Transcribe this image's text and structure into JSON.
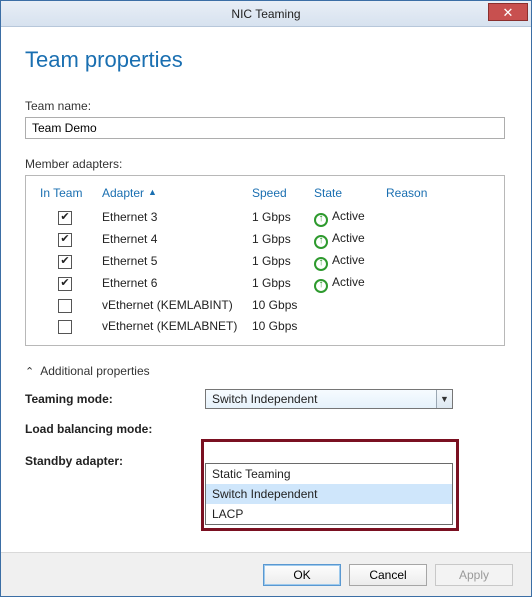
{
  "window": {
    "title": "NIC Teaming",
    "close_glyph": "✕"
  },
  "heading": "Team properties",
  "team_name": {
    "label": "Team name:",
    "value": "Team Demo"
  },
  "member_adapters": {
    "label": "Member adapters:",
    "columns": {
      "in_team": "In Team",
      "adapter": "Adapter",
      "speed": "Speed",
      "state": "State",
      "reason": "Reason"
    },
    "rows": [
      {
        "checked": true,
        "adapter": "Ethernet 3",
        "speed": "1 Gbps",
        "state": "Active",
        "reason": ""
      },
      {
        "checked": true,
        "adapter": "Ethernet 4",
        "speed": "1 Gbps",
        "state": "Active",
        "reason": ""
      },
      {
        "checked": true,
        "adapter": "Ethernet 5",
        "speed": "1 Gbps",
        "state": "Active",
        "reason": ""
      },
      {
        "checked": true,
        "adapter": "Ethernet 6",
        "speed": "1 Gbps",
        "state": "Active",
        "reason": ""
      },
      {
        "checked": false,
        "adapter": "vEthernet (KEMLABINT)",
        "speed": "10 Gbps",
        "state": "",
        "reason": ""
      },
      {
        "checked": false,
        "adapter": "vEthernet (KEMLABNET)",
        "speed": "10 Gbps",
        "state": "",
        "reason": ""
      }
    ]
  },
  "additional": {
    "toggle_label": "Additional properties",
    "expanded": true,
    "teaming_mode": {
      "label": "Teaming mode:",
      "value": "Switch Independent",
      "options": [
        "Static Teaming",
        "Switch Independent",
        "LACP"
      ]
    },
    "load_balancing": {
      "label": "Load balancing mode:"
    },
    "standby_adapter": {
      "label": "Standby adapter:"
    }
  },
  "buttons": {
    "ok": "OK",
    "cancel": "Cancel",
    "apply": "Apply"
  }
}
